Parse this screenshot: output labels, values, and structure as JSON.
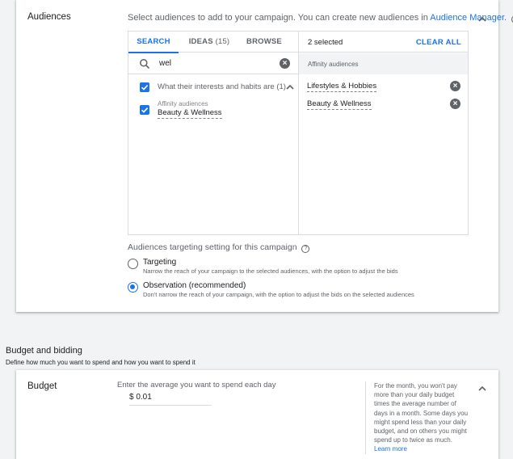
{
  "audiences": {
    "section_label": "Audiences",
    "intro_text": "Select audiences to add to your campaign. You can create new audiences in",
    "intro_link": "Audience Manager.",
    "help_icon": "?",
    "tabs": [
      {
        "label": "SEARCH",
        "count": ""
      },
      {
        "label": "IDEAS",
        "count": "(15)"
      },
      {
        "label": "BROWSE",
        "count": ""
      }
    ],
    "search": {
      "value": "wel",
      "clear_icon": "×"
    },
    "results": {
      "group_title": "What their interests and habits are (1)",
      "item_category": "Affinity audiences",
      "item_label": "Beauty & Wellness"
    },
    "selected": {
      "count": "2 selected",
      "clear_all": "CLEAR ALL",
      "group_label": "Affinity audiences",
      "items": [
        "Lifestyles & Hobbies",
        "Beauty & Wellness"
      ]
    },
    "targeting": {
      "title": "Audiences targeting setting for this campaign",
      "options": [
        {
          "label": "Targeting",
          "desc": "Narrow the reach of your campaign to the selected audiences, with the option to adjust the bids",
          "selected": false
        },
        {
          "label": "Observation (recommended)",
          "desc": "Don't narrow the reach of your campaign, with the option to adjust the bids on the selected audiences",
          "selected": true
        }
      ]
    }
  },
  "budget_bidding": {
    "title": "Budget and bidding",
    "subtitle": "Define how much you want to spend and how you want to spend it",
    "budget": {
      "label": "Budget",
      "prompt": "Enter the average you want to spend each day",
      "amount": "$ 0.01",
      "note": "For the month, you won't pay more than your daily budget times the average number of days in a month. Some days you might spend less than your daily budget, and on others you might spend up to twice as much.",
      "note_link": "Learn more"
    }
  },
  "colors": {
    "accent": "#1a73e8",
    "text": "#202124",
    "muted": "#5f6368",
    "border": "#dadce0"
  }
}
